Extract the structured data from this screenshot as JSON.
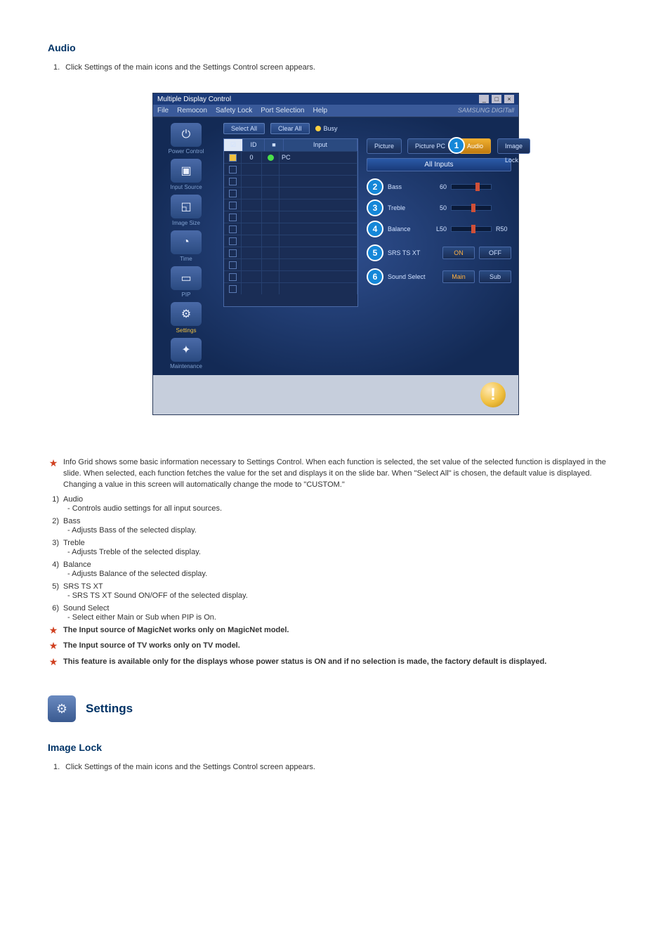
{
  "section1": {
    "title": "Audio",
    "step_num": "1.",
    "step_text": "Click Settings of the main icons and the Settings Control screen appears."
  },
  "window": {
    "title": "Multiple Display Control",
    "menu": [
      "File",
      "Remocon",
      "Safety Lock",
      "Port Selection",
      "Help"
    ],
    "brand": "SAMSUNG DIGITall",
    "sidebar": [
      {
        "label": "Power Control",
        "glyph": "⏻"
      },
      {
        "label": "Input Source",
        "glyph": "▣"
      },
      {
        "label": "Image Size",
        "glyph": "◱"
      },
      {
        "label": "Time",
        "glyph": "◔"
      },
      {
        "label": "PIP",
        "glyph": "▭"
      },
      {
        "label": "Settings",
        "glyph": "⚙",
        "selected": true
      },
      {
        "label": "Maintenance",
        "glyph": "✦"
      }
    ],
    "toolbar": {
      "select_all": "Select All",
      "clear_all": "Clear All",
      "busy": "Busy"
    },
    "grid": {
      "headers": {
        "chk": "☑",
        "id": "ID",
        "st": "■",
        "input": "Input"
      },
      "first_row": {
        "id": "0",
        "input": "PC",
        "on": true
      },
      "blank_rows": 11
    },
    "panel": {
      "tabs": [
        "Picture",
        "Picture PC",
        "Audio",
        "Image Lock"
      ],
      "tab_badge": "1",
      "all_inputs": "All Inputs",
      "sliders": [
        {
          "badge": "2",
          "label": "Bass",
          "value_label": "60",
          "pos": 60,
          "right": ""
        },
        {
          "badge": "3",
          "label": "Treble",
          "value_label": "50",
          "pos": 50,
          "right": ""
        },
        {
          "badge": "4",
          "label": "Balance",
          "value_label": "L50",
          "pos": 50,
          "right": "R50"
        }
      ],
      "row5": {
        "badge": "5",
        "label": "SRS TS XT",
        "on": "ON",
        "off": "OFF"
      },
      "row6": {
        "badge": "6",
        "label": "Sound Select",
        "main": "Main",
        "sub": "Sub"
      }
    },
    "status_icon": "!"
  },
  "notes": {
    "intro": "Info Grid shows some basic information necessary to Settings Control. When each function is selected, the set value of the selected function is displayed in the slide. When selected, each function fetches the value for the set and displays it on the slide bar. When \"Select All\" is chosen, the default value is displayed. Changing a value in this screen will automatically change the mode to \"CUSTOM.\"",
    "items": [
      {
        "n": "1)",
        "title": "Audio",
        "sub": "- Controls audio settings for all input sources."
      },
      {
        "n": "2)",
        "title": "Bass",
        "sub": "- Adjusts Bass of the selected display."
      },
      {
        "n": "3)",
        "title": "Treble",
        "sub": "- Adjusts Treble of the selected display."
      },
      {
        "n": "4)",
        "title": "Balance",
        "sub": "- Adjusts Balance of the selected display."
      },
      {
        "n": "5)",
        "title": "SRS TS XT",
        "sub": "- SRS TS XT Sound ON/OFF of the selected display."
      },
      {
        "n": "6)",
        "title": "Sound Select",
        "sub": "- Select either Main or Sub when PIP is On."
      }
    ],
    "bold1": "The Input source of MagicNet works only on MagicNet model.",
    "bold2": "The Input source of TV works only on TV model.",
    "bold3": "This feature is available only for the displays whose power status is ON and if no selection is made, the factory default is displayed."
  },
  "section2": {
    "heading": "Settings",
    "title": "Image Lock",
    "step_num": "1.",
    "step_text": "Click Settings of the main icons and the Settings Control screen appears."
  }
}
